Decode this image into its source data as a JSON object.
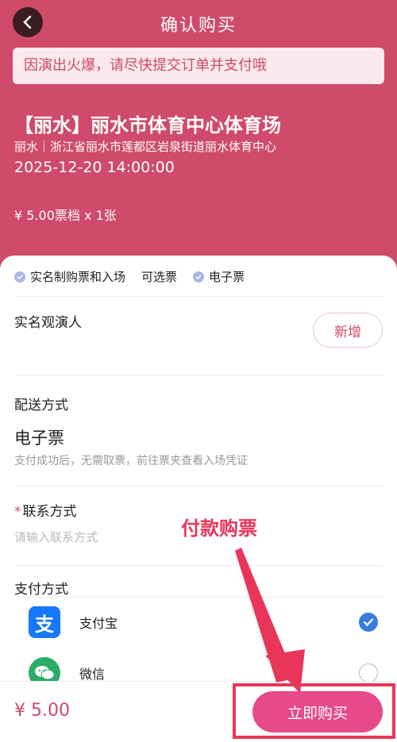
{
  "header": {
    "title": "确认购买",
    "notice": "因演出火爆，请尽快提交订单并支付哦"
  },
  "show": {
    "venue_title": "【丽水】丽水市体育中心体育场",
    "address": "丽水｜浙江省丽水市莲都区岩泉街道丽水体育中心",
    "time": "2025-12-20 14:00:00",
    "ticket_info": "¥ 5.00票档 x 1张"
  },
  "tags": [
    "实名制购票和入场",
    "可选票",
    "电子票"
  ],
  "viewer": {
    "label": "实名观演人",
    "add_label": "新增"
  },
  "delivery": {
    "label": "配送方式",
    "value": "电子票",
    "hint": "支付成功后，无需取票，前往票夹查看入场凭证"
  },
  "contact": {
    "star": "*",
    "label": "联系方式",
    "placeholder": "请输入联系方式"
  },
  "payment": {
    "label": "支付方式",
    "options": [
      {
        "name": "支付宝",
        "icon": "alipay-icon",
        "icon_glyph": "支",
        "color": "#1677ff",
        "selected": true
      },
      {
        "name": "微信",
        "icon": "wechat-icon",
        "color": "#2aae67",
        "selected": false
      }
    ]
  },
  "footer": {
    "total": "¥ 5.00",
    "buy_label": "立即购买"
  },
  "annotation": {
    "text": "付款购票",
    "color": "#e8365a"
  },
  "colors": {
    "brand": "#d04a6a",
    "button": "#e64a8a",
    "check": "#3a7be0"
  }
}
